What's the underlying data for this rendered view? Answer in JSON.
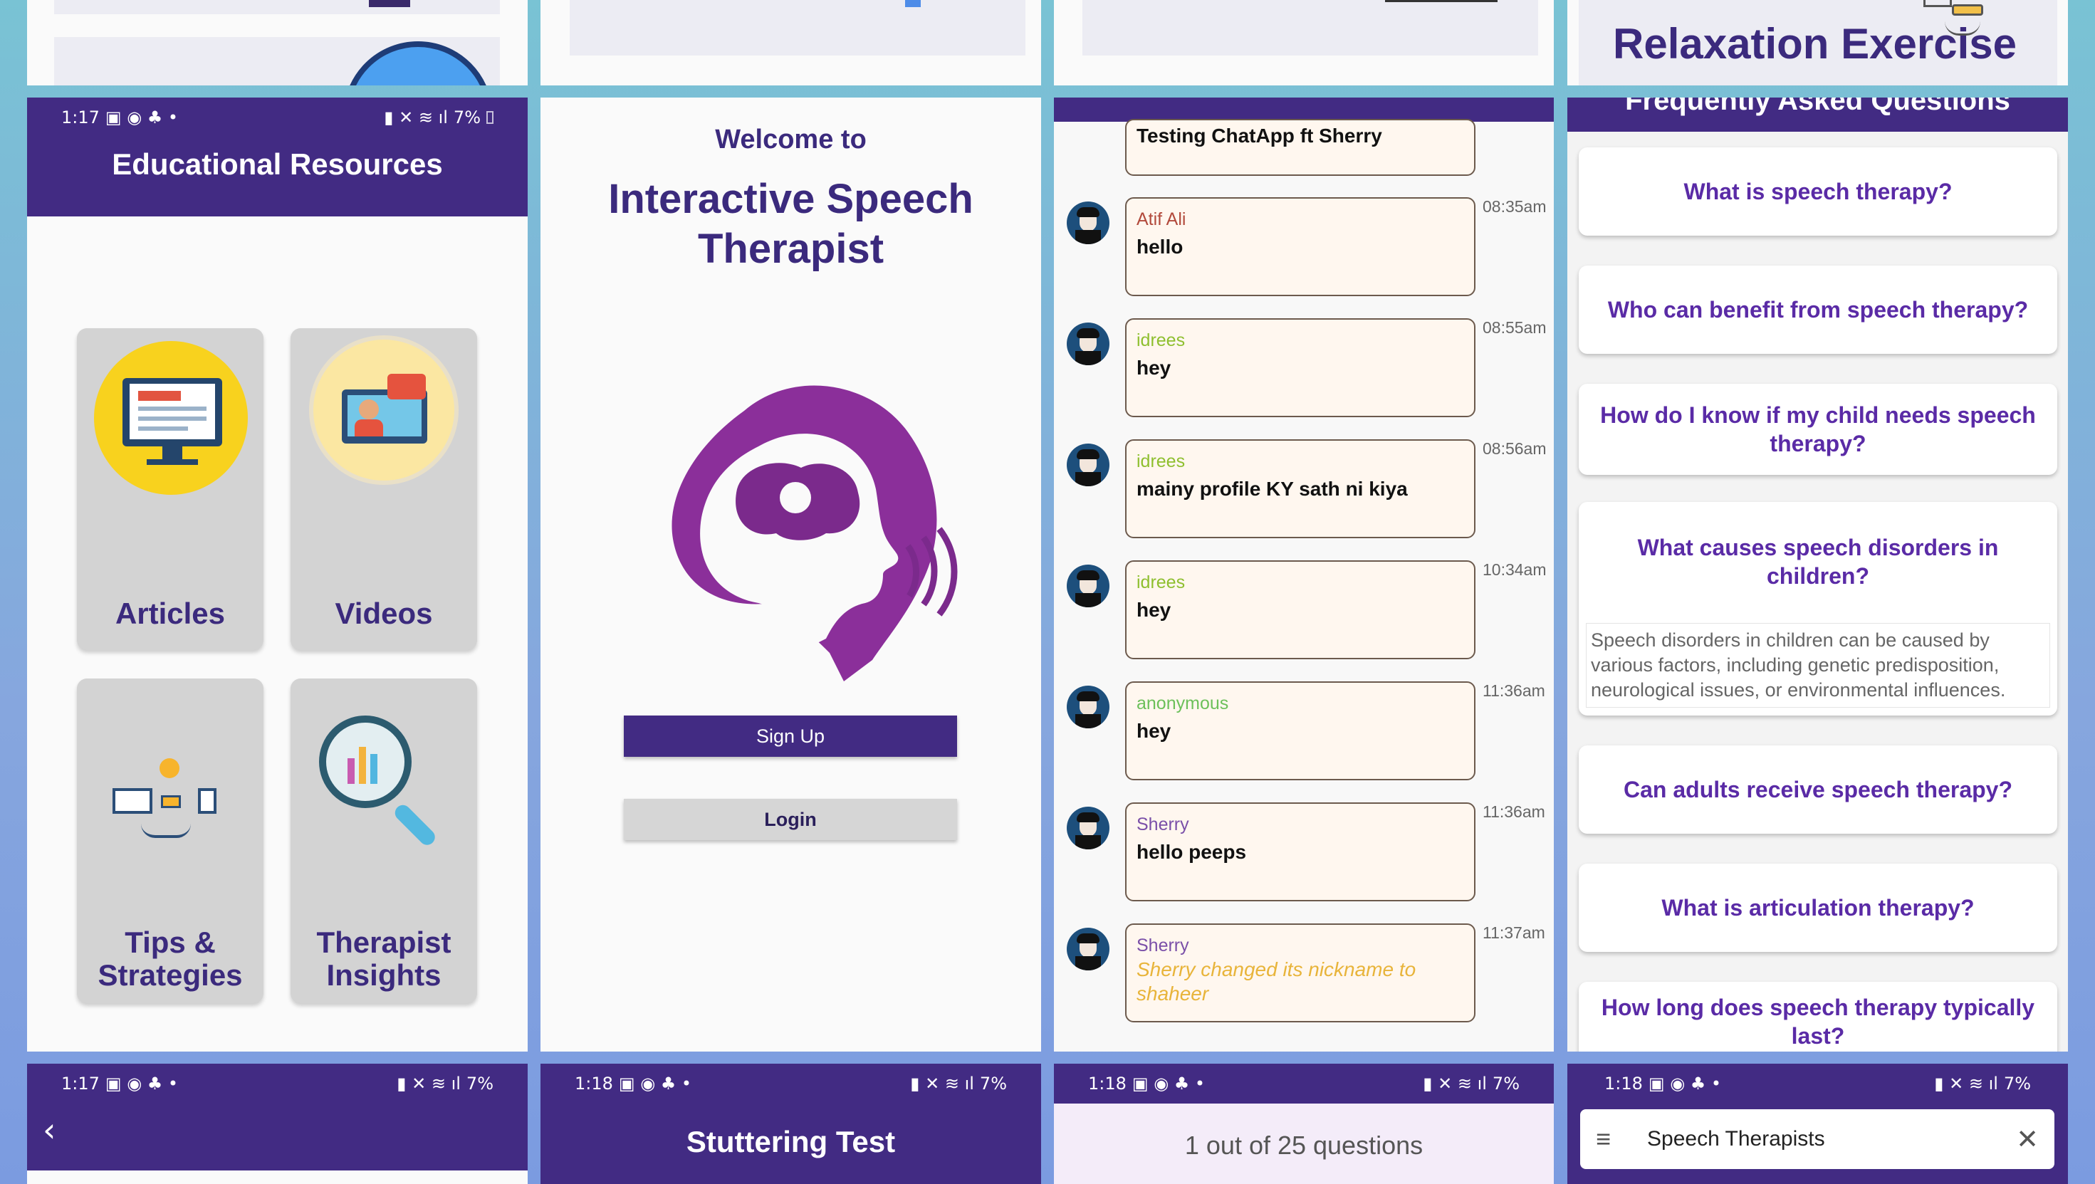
{
  "colors": {
    "header": "#422b83",
    "accent_purple": "#5a2ba6",
    "chat_bubble": "#fff7ef"
  },
  "panel1": {
    "status": {
      "time": "1:17",
      "battery": "7%"
    },
    "header_title": "Educational Resources",
    "tiles": [
      {
        "label": "Articles",
        "icon": "monitor-document-icon"
      },
      {
        "label": "Videos",
        "icon": "video-lesson-icon"
      },
      {
        "label": "Tips & Strategies",
        "icon": "lightbulb-ideas-icon"
      },
      {
        "label": "Therapist Insights",
        "icon": "magnifier-chart-icon"
      }
    ]
  },
  "panel2": {
    "welcome": "Welcome to",
    "app_title": "Interactive Speech Therapist",
    "logo": "head-brain-speech-logo",
    "signup_label": "Sign Up",
    "login_label": "Login"
  },
  "panel3": {
    "partial_message": "Testing ChatApp ft Sherry",
    "messages": [
      {
        "name": "Atif Ali",
        "name_color": "#b24a3c",
        "text": "hello",
        "time": "08:35am"
      },
      {
        "name": "idrees",
        "name_color": "#8fbf2f",
        "text": "hey",
        "time": "08:55am"
      },
      {
        "name": "idrees",
        "name_color": "#8fbf2f",
        "text": "mainy profile KY sath ni kiya",
        "time": "08:56am"
      },
      {
        "name": "idrees",
        "name_color": "#8fbf2f",
        "text": "hey",
        "time": "10:34am"
      },
      {
        "name": "anonymous",
        "name_color": "#6cc05a",
        "text": "hey",
        "time": "11:36am"
      },
      {
        "name": "Sherry",
        "name_color": "#7a4fa8",
        "text": "hello peeps",
        "time": "11:36am"
      },
      {
        "name": "Sherry",
        "name_color": "#7a4fa8",
        "text": "Sherry changed its nickname to shaheer",
        "time": "11:37am",
        "system": true
      }
    ]
  },
  "panel4": {
    "header_partial": "Frequently Asked Questions",
    "faqs": [
      "What is speech therapy?",
      "Who can benefit from speech therapy?",
      "How do I know if my child needs speech therapy?",
      "What causes speech disorders in children?",
      "Can adults receive speech therapy?",
      "What is articulation therapy?",
      "How long does speech therapy typically last?"
    ],
    "expanded_answer": "Speech disorders in children can be caused by various factors, including genetic predisposition, neurological issues, or environmental influences."
  },
  "top4": {
    "title": "Relaxation Exercise"
  },
  "bottom": {
    "b1": {
      "time": "1:17",
      "battery": "7%"
    },
    "b2": {
      "time": "1:18",
      "battery": "7%",
      "title": "Stuttering Test"
    },
    "b3": {
      "time": "1:18",
      "battery": "7%",
      "progress_text": "1 out of 25 questions"
    },
    "b4": {
      "time": "1:18",
      "battery": "7%",
      "search_value": "Speech Therapists"
    }
  }
}
